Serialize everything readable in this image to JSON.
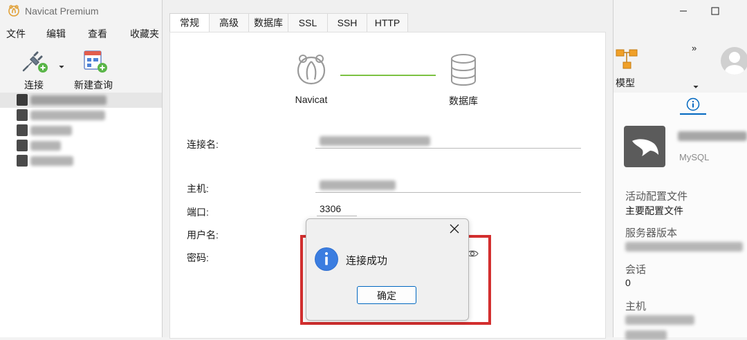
{
  "app": {
    "title": "Navicat Premium"
  },
  "menu": [
    "文件",
    "编辑",
    "查看",
    "收藏夹"
  ],
  "toolbar": {
    "connect_label": "连接",
    "new_query_label": "新建查询",
    "model_label": "模型",
    "overflow_label": "»"
  },
  "dialog": {
    "tabs": [
      "常规",
      "高级",
      "数据库",
      "SSL",
      "SSH",
      "HTTP"
    ],
    "active_tab": "常规",
    "flow_left": "Navicat",
    "flow_right": "数据库",
    "fields": {
      "connection_name_label": "连接名:",
      "host_label": "主机:",
      "port_label": "端口:",
      "port_value": "3306",
      "username_label": "用户名:",
      "password_label": "密码:"
    }
  },
  "message": {
    "text": "连接成功",
    "ok_label": "确定",
    "highlight_color": "#d32f2f"
  },
  "info_panel": {
    "db_type": "MySQL",
    "active_profile_label": "活动配置文件",
    "active_profile_value": "主要配置文件",
    "server_version_label": "服务器版本",
    "sessions_label": "会话",
    "sessions_value": "0",
    "host_label": "主机"
  },
  "colors": {
    "accent": "#0067c0",
    "connected_line": "#7cc242",
    "info_icon": "#2f6fd0"
  }
}
